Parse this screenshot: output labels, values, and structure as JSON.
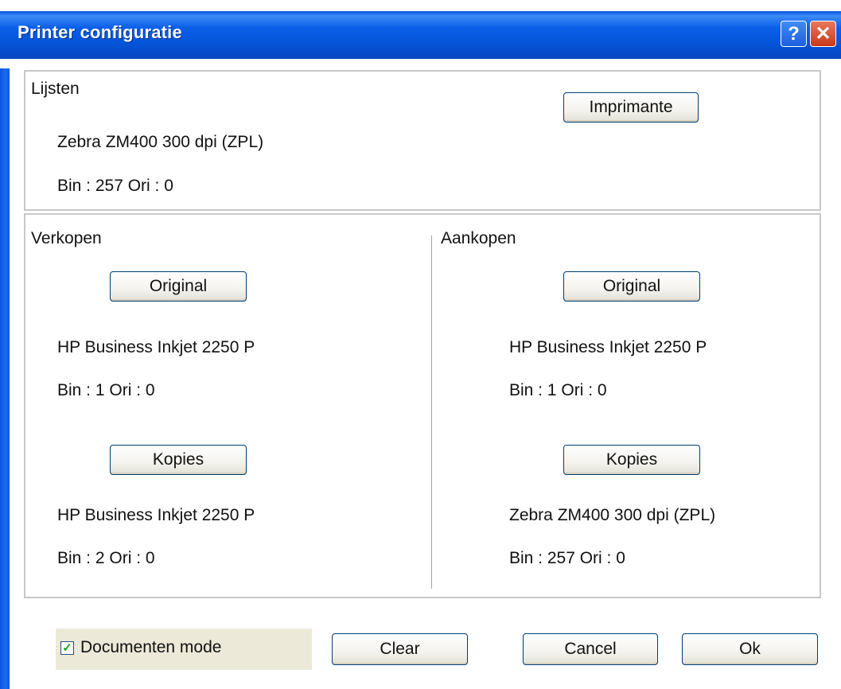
{
  "window": {
    "title": "Printer configuratie",
    "help_label": "?",
    "close_label": "✕"
  },
  "lijsten": {
    "title": "Lijsten",
    "button_label": "Imprimante",
    "printer": "Zebra  ZM400 300 dpi (ZPL)",
    "settings": "Bin : 257 Ori : 0"
  },
  "verkopen": {
    "title": "Verkopen",
    "original_button": "Original",
    "original_printer": "HP Business Inkjet 2250 P",
    "original_settings": "Bin : 1 Ori : 0",
    "kopies_button": "Kopies",
    "kopies_printer": "HP Business Inkjet 2250 P",
    "kopies_settings": "Bin : 2 Ori : 0"
  },
  "aankopen": {
    "title": "Aankopen",
    "original_button": "Original",
    "original_printer": "HP Business Inkjet 2250 P",
    "original_settings": "Bin : 1 Ori : 0",
    "kopies_button": "Kopies",
    "kopies_printer": "Zebra  ZM400 300 dpi (ZPL)",
    "kopies_settings": "Bin : 257 Ori : 0"
  },
  "footer": {
    "documenten_mode_label": "Documenten mode",
    "documenten_mode_checked": true,
    "checkmark": "✓",
    "clear_label": "Clear",
    "cancel_label": "Cancel",
    "ok_label": "Ok"
  },
  "colors": {
    "titlebar": "#0a55e0",
    "close": "#c8381a",
    "button_border": "#003c74",
    "panel_bg": "#ece9d8"
  }
}
